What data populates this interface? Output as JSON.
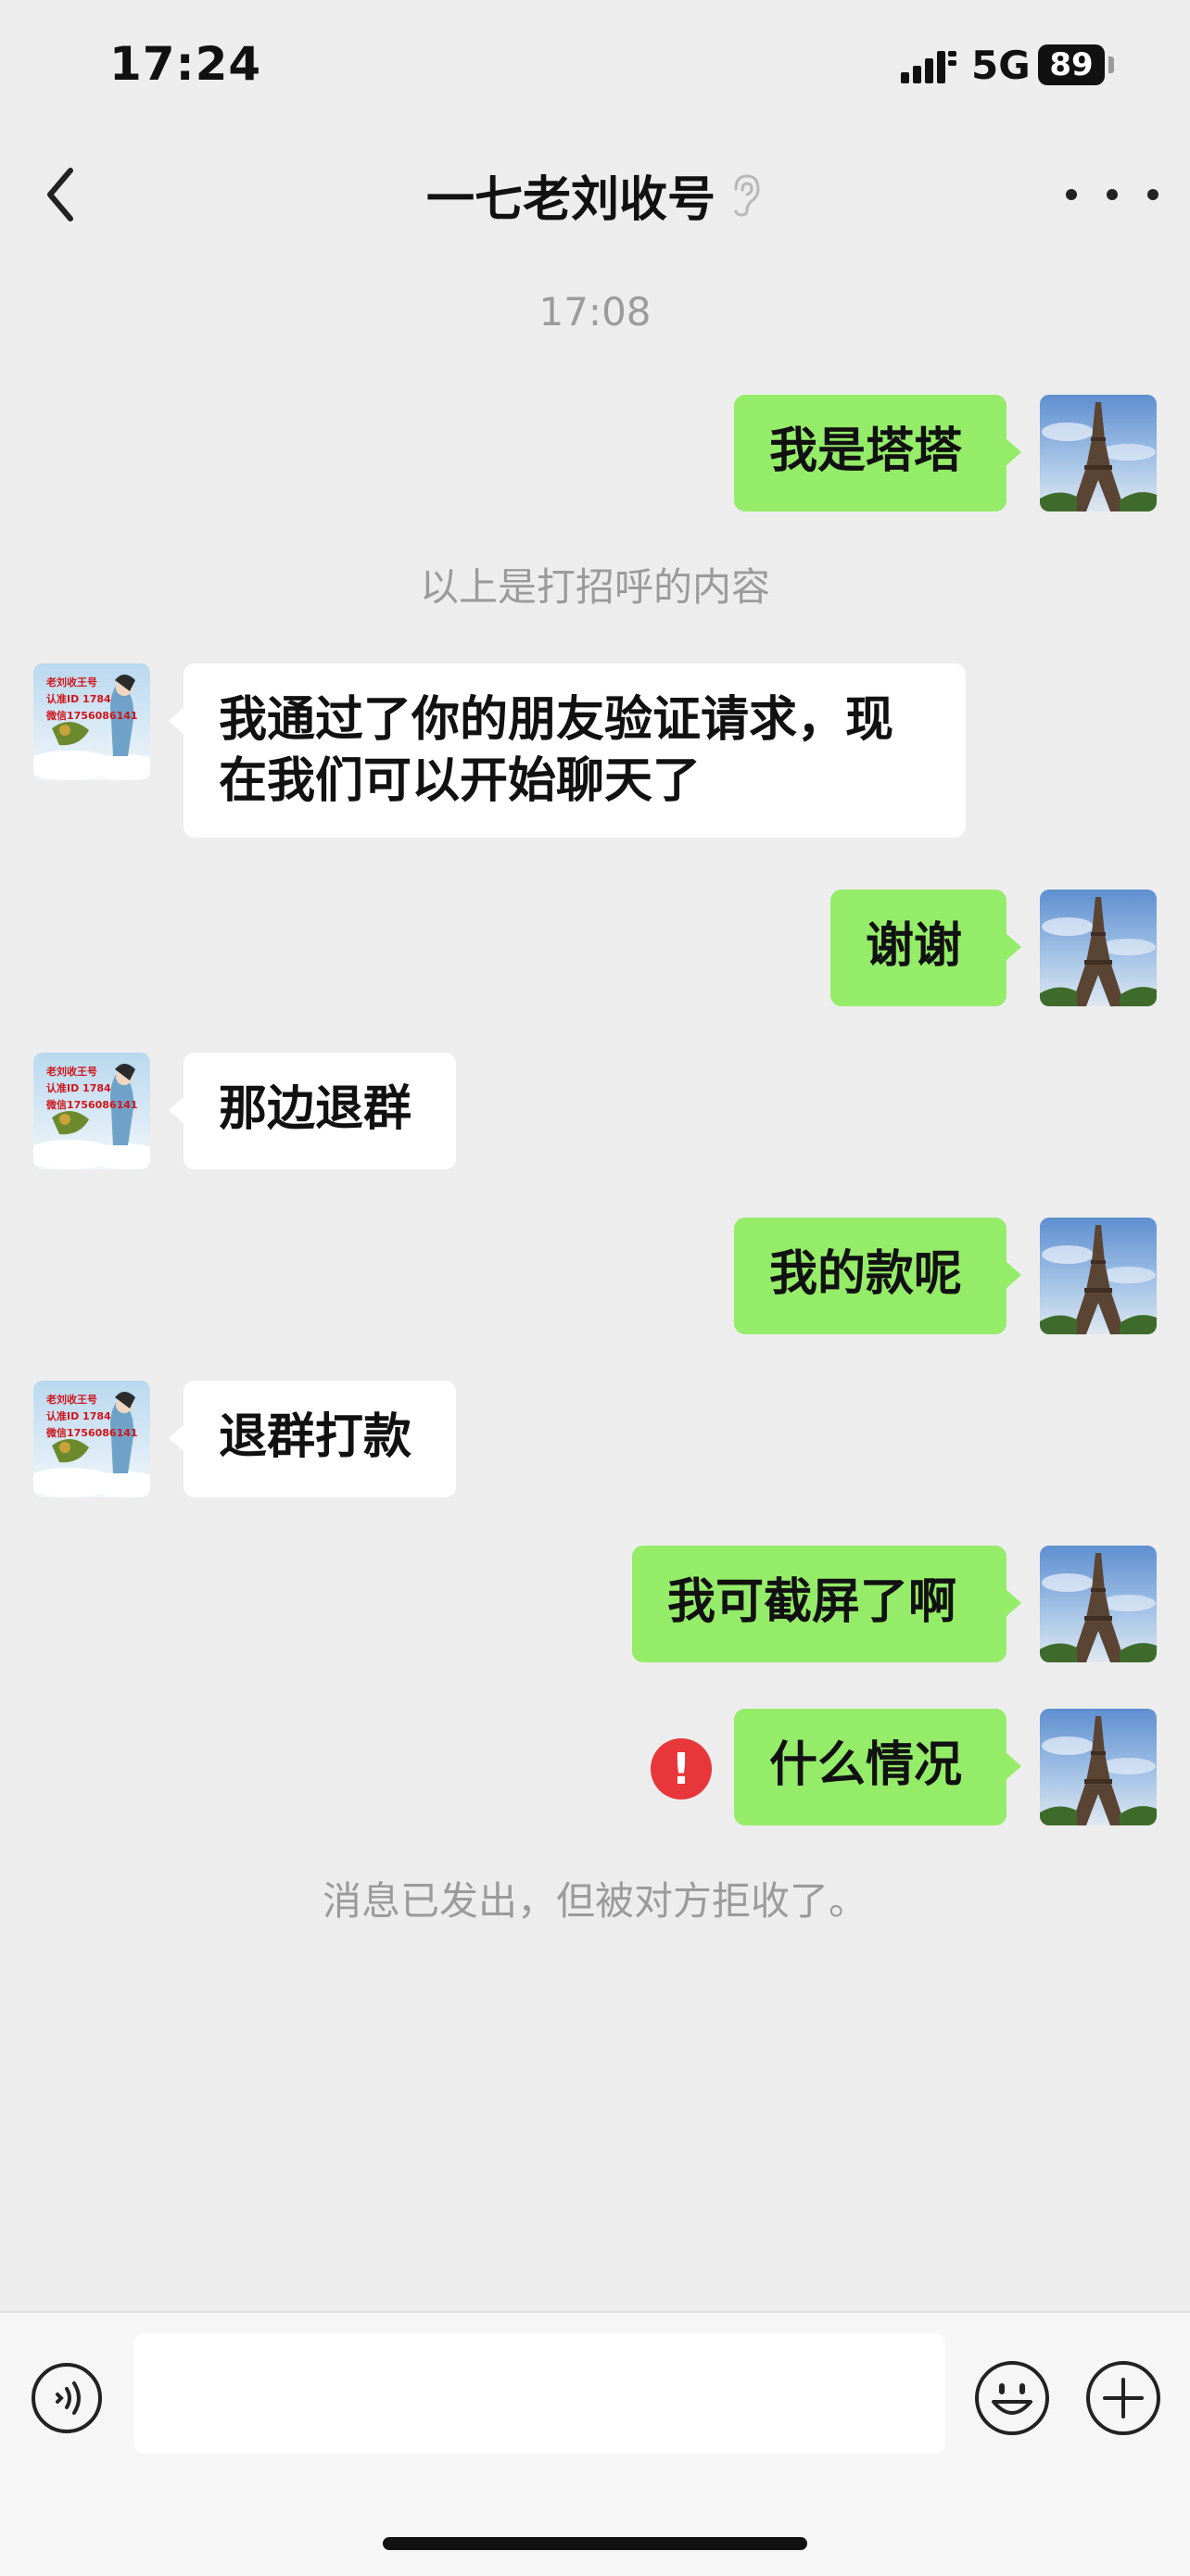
{
  "status_bar": {
    "time": "17:24",
    "network": "5G",
    "battery": "89"
  },
  "header": {
    "title": "一七老刘收号",
    "back_icon": "chevron-left-icon",
    "more_icon": "more-dots-icon",
    "ear_icon": "ear-icon"
  },
  "chat": {
    "timestamp": "17:08",
    "greeting_notice": "以上是打招呼的内容",
    "rejected_notice": "消息已发出，但被对方拒收了。",
    "messages": [
      {
        "side": "right",
        "text": "我是塔塔"
      },
      {
        "side": "left",
        "lines": [
          "我通过了你的朋友验证请求，现",
          "在我们可以开始聊天了"
        ]
      },
      {
        "side": "right",
        "text": "谢谢"
      },
      {
        "side": "left",
        "text": "那边退群"
      },
      {
        "side": "right",
        "text": "我的款呢"
      },
      {
        "side": "left",
        "text": "退群打款"
      },
      {
        "side": "right",
        "text": "我可截屏了啊"
      },
      {
        "side": "right",
        "text": "什么情况",
        "error": "!"
      }
    ],
    "contact_avatar_lines": [
      "老刘收王号",
      "认准ID 1784",
      "微信1756086141"
    ]
  },
  "input_bar": {
    "value": "",
    "voice_icon": "voice-icon",
    "emoji_icon": "emoji-icon",
    "plus_icon": "plus-icon"
  },
  "colors": {
    "sent_bubble": "#95ec69",
    "received_bubble": "#ffffff",
    "background": "#ededed",
    "error": "#e8373b"
  }
}
